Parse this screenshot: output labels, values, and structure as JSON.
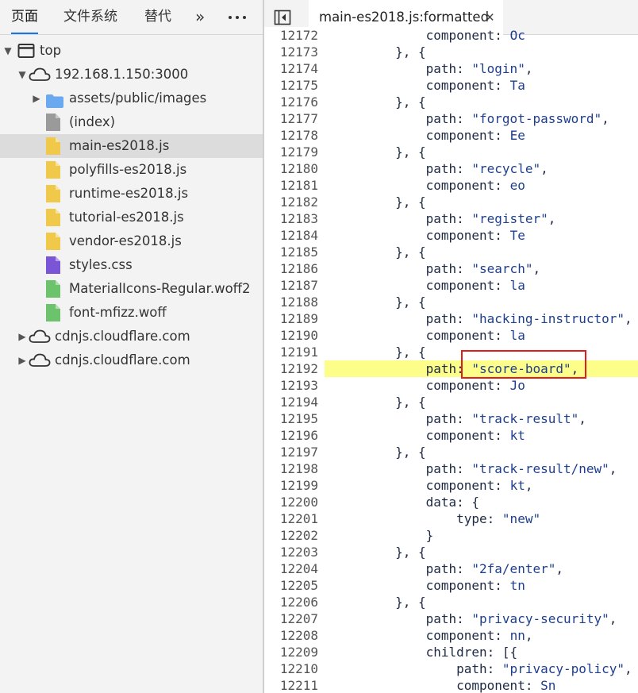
{
  "left_panel": {
    "tabs": [
      "页面",
      "文件系统",
      "替代"
    ],
    "more_tabs": "»",
    "menu": "⋮"
  },
  "tree": [
    {
      "label": "top",
      "icon": "window-icon",
      "indent": 0,
      "expanded": true
    },
    {
      "label": "192.168.1.150:3000",
      "icon": "cloud-icon",
      "indent": 1,
      "expanded": true
    },
    {
      "label": "assets/public/images",
      "icon": "folder-icon",
      "indent": 2,
      "expanded": false
    },
    {
      "label": "(index)",
      "icon": "file-gray-icon",
      "indent": 2
    },
    {
      "label": "main-es2018.js",
      "icon": "file-js-icon",
      "indent": 2,
      "selected": true
    },
    {
      "label": "polyfills-es2018.js",
      "icon": "file-js-icon",
      "indent": 2
    },
    {
      "label": "runtime-es2018.js",
      "icon": "file-js-icon",
      "indent": 2
    },
    {
      "label": "tutorial-es2018.js",
      "icon": "file-js-icon",
      "indent": 2
    },
    {
      "label": "vendor-es2018.js",
      "icon": "file-js-icon",
      "indent": 2
    },
    {
      "label": "styles.css",
      "icon": "file-css-icon",
      "indent": 2
    },
    {
      "label": "MaterialIcons-Regular.woff2",
      "icon": "file-font-icon",
      "indent": 2
    },
    {
      "label": "font-mfizz.woff",
      "icon": "file-font-icon",
      "indent": 2
    },
    {
      "label": "cdnjs.cloudflare.com",
      "icon": "cloud-icon",
      "indent": 1,
      "expanded": false
    },
    {
      "label": "cdnjs.cloudflare.com",
      "icon": "cloud-icon",
      "indent": 1,
      "expanded": false
    }
  ],
  "editor": {
    "tab_title": "main-es2018.js:formatted",
    "close": "✕",
    "highlighted_line": "12192",
    "lines": [
      {
        "n": "12172",
        "t": "            component: Oc"
      },
      {
        "n": "12173",
        "t": "        }, {"
      },
      {
        "n": "12174",
        "t": "            path: \"login\","
      },
      {
        "n": "12175",
        "t": "            component: Ta"
      },
      {
        "n": "12176",
        "t": "        }, {"
      },
      {
        "n": "12177",
        "t": "            path: \"forgot-password\","
      },
      {
        "n": "12178",
        "t": "            component: Ee"
      },
      {
        "n": "12179",
        "t": "        }, {"
      },
      {
        "n": "12180",
        "t": "            path: \"recycle\","
      },
      {
        "n": "12181",
        "t": "            component: eo"
      },
      {
        "n": "12182",
        "t": "        }, {"
      },
      {
        "n": "12183",
        "t": "            path: \"register\","
      },
      {
        "n": "12184",
        "t": "            component: Te"
      },
      {
        "n": "12185",
        "t": "        }, {"
      },
      {
        "n": "12186",
        "t": "            path: \"search\","
      },
      {
        "n": "12187",
        "t": "            component: la"
      },
      {
        "n": "12188",
        "t": "        }, {"
      },
      {
        "n": "12189",
        "t": "            path: \"hacking-instructor\","
      },
      {
        "n": "12190",
        "t": "            component: la"
      },
      {
        "n": "12191",
        "t": "        }, {"
      },
      {
        "n": "12192",
        "t": "            path: \"score-board\","
      },
      {
        "n": "12193",
        "t": "            component: Jo"
      },
      {
        "n": "12194",
        "t": "        }, {"
      },
      {
        "n": "12195",
        "t": "            path: \"track-result\","
      },
      {
        "n": "12196",
        "t": "            component: kt"
      },
      {
        "n": "12197",
        "t": "        }, {"
      },
      {
        "n": "12198",
        "t": "            path: \"track-result/new\","
      },
      {
        "n": "12199",
        "t": "            component: kt,"
      },
      {
        "n": "12200",
        "t": "            data: {"
      },
      {
        "n": "12201",
        "t": "                type: \"new\""
      },
      {
        "n": "12202",
        "t": "            }"
      },
      {
        "n": "12203",
        "t": "        }, {"
      },
      {
        "n": "12204",
        "t": "            path: \"2fa/enter\","
      },
      {
        "n": "12205",
        "t": "            component: tn"
      },
      {
        "n": "12206",
        "t": "        }, {"
      },
      {
        "n": "12207",
        "t": "            path: \"privacy-security\","
      },
      {
        "n": "12208",
        "t": "            component: nn,"
      },
      {
        "n": "12209",
        "t": "            children: [{"
      },
      {
        "n": "12210",
        "t": "                path: \"privacy-policy\","
      },
      {
        "n": "12211",
        "t": "                component: Sn"
      }
    ]
  },
  "colors": {
    "accent": "#1a73e8",
    "highlight": "#fdfd8a",
    "annotation_box": "#e21b1b",
    "js_file": "#f0c94a",
    "css_file": "#7a55d6",
    "font_file": "#6cc36c",
    "folder": "#6aa9ef"
  }
}
